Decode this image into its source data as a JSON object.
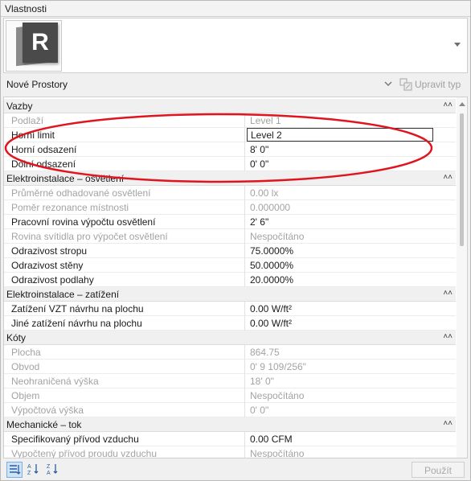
{
  "window": {
    "title": "Vlastnosti"
  },
  "preview": {
    "logo_letter": "R",
    "icon": "revit-logo-icon"
  },
  "type_selector": {
    "value": "Nové Prostory",
    "edit_type_label": "Upravit typ"
  },
  "groups": [
    {
      "title": "Vazby",
      "rows": [
        {
          "name": "Podlaží",
          "value": "Level 1",
          "dim": true
        },
        {
          "name": "Horní limit",
          "value": "Level 2",
          "dim": false,
          "editing": true
        },
        {
          "name": "Horní odsazení",
          "value": "8'  0\"",
          "dim": false
        },
        {
          "name": "Dolní odsazení",
          "value": "0'  0\"",
          "dim": false
        }
      ]
    },
    {
      "title": "Elektroinstalace – osvětlení",
      "rows": [
        {
          "name": "Průměrné odhadované osvětlení",
          "value": "0.00 lx",
          "dim": true
        },
        {
          "name": "Poměr rezonance místnosti",
          "value": "0.000000",
          "dim": true
        },
        {
          "name": "Pracovní rovina výpočtu osvětlení",
          "value": "2'  6\"",
          "dim": false
        },
        {
          "name": "Rovina svítidla pro výpočet osvětlení",
          "value": "Nespočítáno",
          "dim": true
        },
        {
          "name": "Odrazivost stropu",
          "value": "75.0000%",
          "dim": false
        },
        {
          "name": "Odrazivost stěny",
          "value": "50.0000%",
          "dim": false
        },
        {
          "name": "Odrazivost podlahy",
          "value": "20.0000%",
          "dim": false
        }
      ]
    },
    {
      "title": "Elektroinstalace – zatížení",
      "rows": [
        {
          "name": "Zatížení VZT návrhu na plochu",
          "value": "0.00 W/ft²",
          "dim": false
        },
        {
          "name": "Jiné zatížení návrhu na plochu",
          "value": "0.00 W/ft²",
          "dim": false
        }
      ]
    },
    {
      "title": "Kóty",
      "rows": [
        {
          "name": "Plocha",
          "value": "864.75",
          "dim": true
        },
        {
          "name": "Obvod",
          "value": "0'  9 109/256\"",
          "dim": true
        },
        {
          "name": "Neohraničená výška",
          "value": "18'  0\"",
          "dim": true
        },
        {
          "name": "Objem",
          "value": "Nespočítáno",
          "dim": true
        },
        {
          "name": "Výpočtová výška",
          "value": "0'  0\"",
          "dim": true
        }
      ]
    },
    {
      "title": "Mechanické – tok",
      "rows": [
        {
          "name": "Specifikovaný přívod vzduchu",
          "value": "0.00 CFM",
          "dim": false
        },
        {
          "name": "Vypočtený přívod proudu vzduchu",
          "value": "Nespočítáno",
          "dim": true
        }
      ]
    }
  ],
  "footer": {
    "apply_label": "Použít"
  },
  "colors": {
    "highlight_ellipse": "#e0141e",
    "active_sort_bg": "#cfe3f7"
  }
}
